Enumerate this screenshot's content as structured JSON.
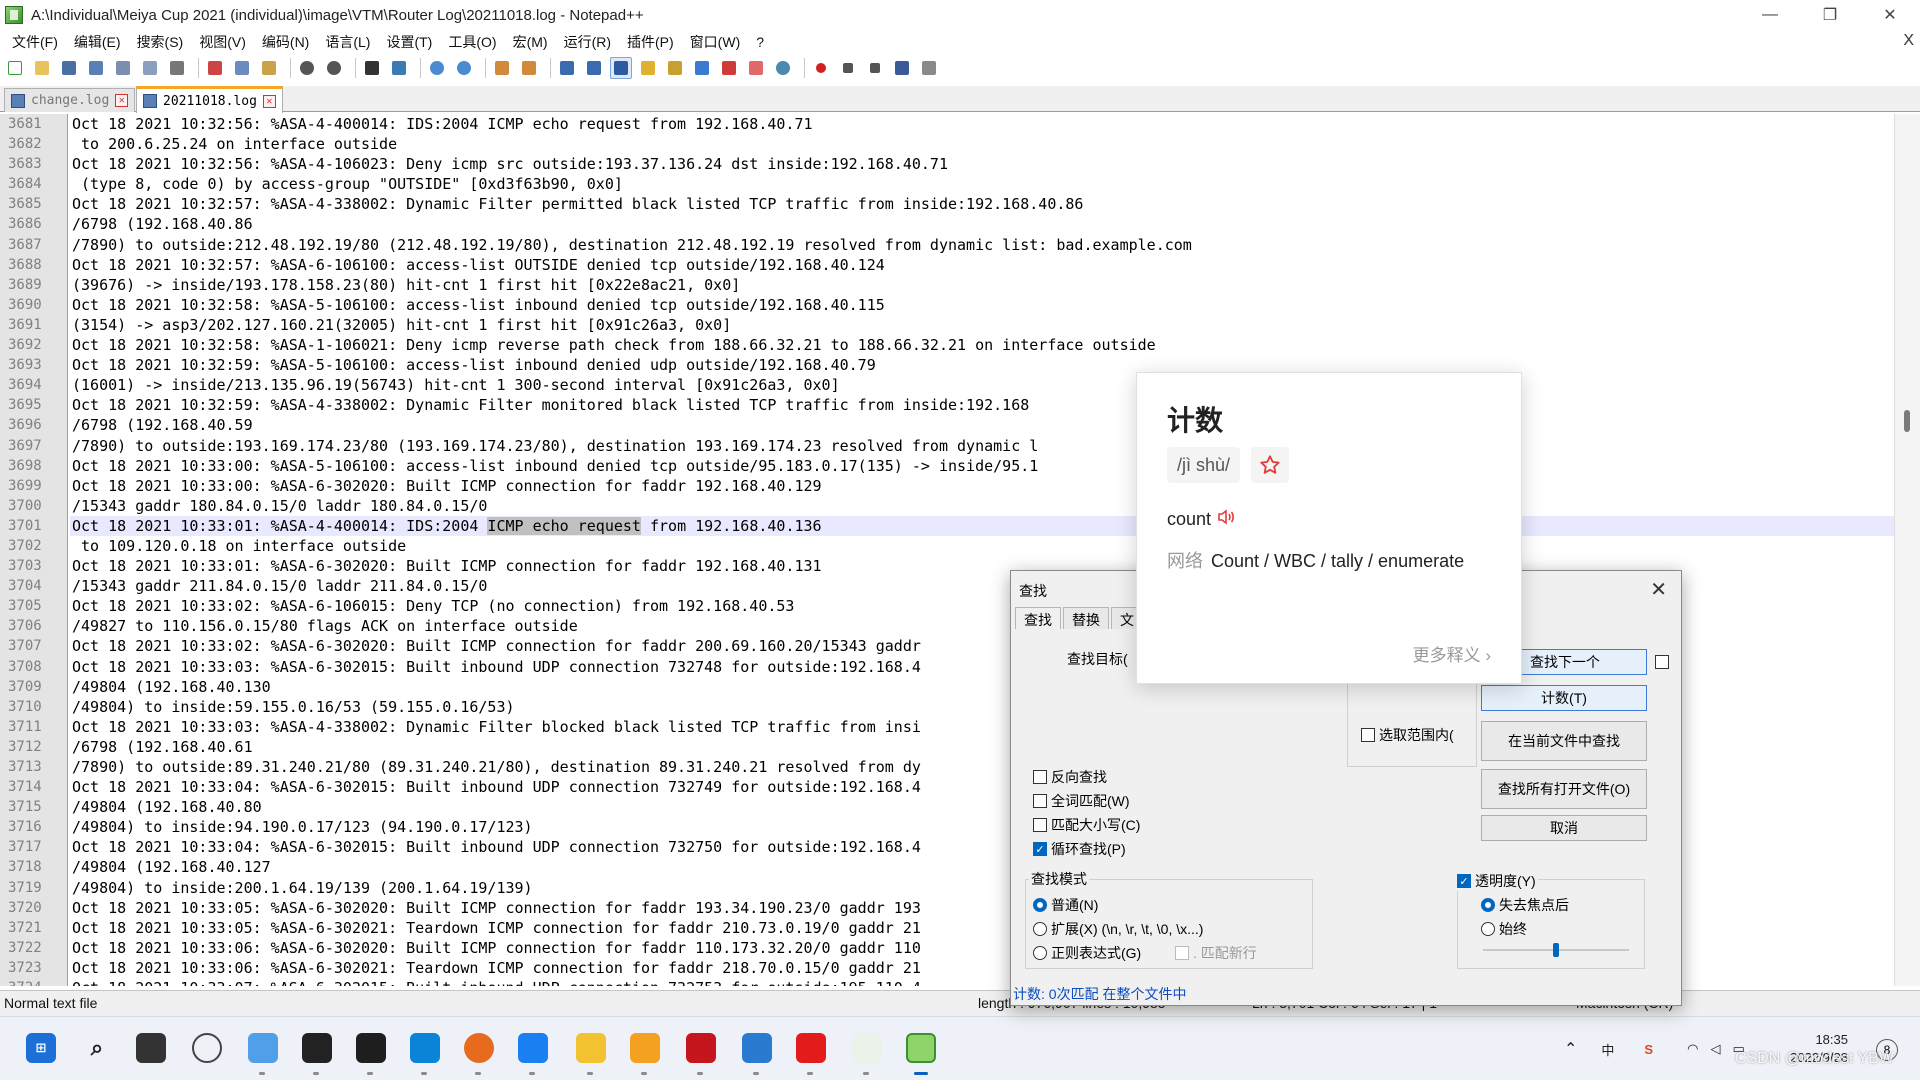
{
  "window": {
    "title": "A:\\Individual\\Meiya Cup 2021 (individual)\\image\\VTM\\Router Log\\20211018.log - Notepad++",
    "minimize": "—",
    "maximize": "❐",
    "close": "✕"
  },
  "menu": {
    "items": [
      "文件(F)",
      "编辑(E)",
      "搜索(S)",
      "视图(V)",
      "编码(N)",
      "语言(L)",
      "设置(T)",
      "工具(O)",
      "宏(M)",
      "运行(R)",
      "插件(P)",
      "窗口(W)",
      "?"
    ],
    "close": "X"
  },
  "tabs": [
    {
      "label": "change.log",
      "active": false
    },
    {
      "label": "20211018.log",
      "active": true
    }
  ],
  "editor": {
    "current_line": 3701,
    "selection": "ICMP echo request",
    "lines": [
      {
        "n": "3681",
        "t": "Oct 18 2021 10:32:56: %ASA-4-400014: IDS:2004 ICMP echo request from 192.168.40.71"
      },
      {
        "n": "3682",
        "t": " to 200.6.25.24 on interface outside"
      },
      {
        "n": "3683",
        "t": "Oct 18 2021 10:32:56: %ASA-4-106023: Deny icmp src outside:193.37.136.24 dst inside:192.168.40.71"
      },
      {
        "n": "3684",
        "t": " (type 8, code 0) by access-group \"OUTSIDE\" [0xd3f63b90, 0x0]"
      },
      {
        "n": "3685",
        "t": "Oct 18 2021 10:32:57: %ASA-4-338002: Dynamic Filter permitted black listed TCP traffic from inside:192.168.40.86"
      },
      {
        "n": "3686",
        "t": "/6798 (192.168.40.86"
      },
      {
        "n": "3687",
        "t": "/7890) to outside:212.48.192.19/80 (212.48.192.19/80), destination 212.48.192.19 resolved from dynamic list: bad.example.com"
      },
      {
        "n": "3688",
        "t": "Oct 18 2021 10:32:57: %ASA-6-106100: access-list OUTSIDE denied tcp outside/192.168.40.124"
      },
      {
        "n": "3689",
        "t": "(39676) -> inside/193.178.158.23(80) hit-cnt 1 first hit [0x22e8ac21, 0x0]"
      },
      {
        "n": "3690",
        "t": "Oct 18 2021 10:32:58: %ASA-5-106100: access-list inbound denied tcp outside/192.168.40.115"
      },
      {
        "n": "3691",
        "t": "(3154) -> asp3/202.127.160.21(32005) hit-cnt 1 first hit [0x91c26a3, 0x0]"
      },
      {
        "n": "3692",
        "t": "Oct 18 2021 10:32:58: %ASA-1-106021: Deny icmp reverse path check from 188.66.32.21 to 188.66.32.21 on interface outside"
      },
      {
        "n": "3693",
        "t": "Oct 18 2021 10:32:59: %ASA-5-106100: access-list inbound denied udp outside/192.168.40.79"
      },
      {
        "n": "3694",
        "t": "(16001) -> inside/213.135.96.19(56743) hit-cnt 1 300-second interval [0x91c26a3, 0x0]"
      },
      {
        "n": "3695",
        "t": "Oct 18 2021 10:32:59: %ASA-4-338002: Dynamic Filter monitored black listed TCP traffic from inside:192.168"
      },
      {
        "n": "3696",
        "t": "/6798 (192.168.40.59"
      },
      {
        "n": "3697",
        "t": "/7890) to outside:193.169.174.23/80 (193.169.174.23/80), destination 193.169.174.23 resolved from dynamic l"
      },
      {
        "n": "3698",
        "t": "Oct 18 2021 10:33:00: %ASA-5-106100: access-list inbound denied tcp outside/95.183.0.17(135) -> inside/95.1                             1c26a3, 0x0]"
      },
      {
        "n": "3699",
        "t": "Oct 18 2021 10:33:00: %ASA-6-302020: Built ICMP connection for faddr 192.168.40.129"
      },
      {
        "n": "3700",
        "t": "/15343 gaddr 180.84.0.15/0 laddr 180.84.0.15/0"
      },
      {
        "n": "3701",
        "t": "Oct 18 2021 10:33:01: %ASA-4-400014: IDS:2004 ICMP echo request from 192.168.40.136"
      },
      {
        "n": "3702",
        "t": " to 109.120.0.18 on interface outside"
      },
      {
        "n": "3703",
        "t": "Oct 18 2021 10:33:01: %ASA-6-302020: Built ICMP connection for faddr 192.168.40.131"
      },
      {
        "n": "3704",
        "t": "/15343 gaddr 211.84.0.15/0 laddr 211.84.0.15/0"
      },
      {
        "n": "3705",
        "t": "Oct 18 2021 10:33:02: %ASA-6-106015: Deny TCP (no connection) from 192.168.40.53"
      },
      {
        "n": "3706",
        "t": "/49827 to 110.156.0.15/80 flags ACK on interface outside"
      },
      {
        "n": "3707",
        "t": "Oct 18 2021 10:33:02: %ASA-6-302020: Built ICMP connection for faddr 200.69.160.20/15343 gaddr"
      },
      {
        "n": "3708",
        "t": "Oct 18 2021 10:33:03: %ASA-6-302015: Built inbound UDP connection 732748 for outside:192.168.4"
      },
      {
        "n": "3709",
        "t": "/49804 (192.168.40.130"
      },
      {
        "n": "3710",
        "t": "/49804) to inside:59.155.0.16/53 (59.155.0.16/53)"
      },
      {
        "n": "3711",
        "t": "Oct 18 2021 10:33:03: %ASA-4-338002: Dynamic Filter blocked black listed TCP traffic from insi"
      },
      {
        "n": "3712",
        "t": "/6798 (192.168.40.61"
      },
      {
        "n": "3713",
        "t": "/7890) to outside:89.31.240.21/80 (89.31.240.21/80), destination 89.31.240.21 resolved from dy"
      },
      {
        "n": "3714",
        "t": "Oct 18 2021 10:33:04: %ASA-6-302015: Built inbound UDP connection 732749 for outside:192.168.4"
      },
      {
        "n": "3715",
        "t": "/49804 (192.168.40.80"
      },
      {
        "n": "3716",
        "t": "/49804) to inside:94.190.0.17/123 (94.190.0.17/123)"
      },
      {
        "n": "3717",
        "t": "Oct 18 2021 10:33:04: %ASA-6-302015: Built inbound UDP connection 732750 for outside:192.168.4"
      },
      {
        "n": "3718",
        "t": "/49804 (192.168.40.127"
      },
      {
        "n": "3719",
        "t": "/49804) to inside:200.1.64.19/139 (200.1.64.19/139)"
      },
      {
        "n": "3720",
        "t": "Oct 18 2021 10:33:05: %ASA-6-302020: Built ICMP connection for faddr 193.34.190.23/0 gaddr 193"
      },
      {
        "n": "3721",
        "t": "Oct 18 2021 10:33:05: %ASA-6-302021: Teardown ICMP connection for faddr 210.73.0.19/0 gaddr 21"
      },
      {
        "n": "3722",
        "t": "Oct 18 2021 10:33:06: %ASA-6-302020: Built ICMP connection for faddr 110.173.32.20/0 gaddr 110"
      },
      {
        "n": "3723",
        "t": "Oct 18 2021 10:33:06: %ASA-6-302021: Teardown ICMP connection for faddr 218.70.0.15/0 gaddr 21"
      },
      {
        "n": "3724",
        "t": "Oct 18 2021 10:33:07: %ASA-6-302015: Built inbound UDP connection 732753 for outside:195.110.4                                                                   22/53)"
      }
    ]
  },
  "statusbar": {
    "file_type": "Normal text file",
    "length": "length : 976,907   lines : 10,985",
    "position": "Ln : 3,701   Col : 64   Sel : 17 | 1",
    "eol": "Macintosh (CR)"
  },
  "find_dialog": {
    "title": "查找",
    "tabs": [
      "查找",
      "替换",
      "文"
    ],
    "target_label": "查找目标(",
    "btn_find_next": "查找下一个",
    "btn_count": "计数(T)",
    "btn_find_in_current": "在当前文件中查找",
    "btn_find_all_open": "查找所有打开文件(O)",
    "btn_cancel": "取消",
    "in_selection": "选取范围内(",
    "opt_backward": "反向查找",
    "opt_whole_word": "全词匹配(W)",
    "opt_match_case": "匹配大小写(C)",
    "opt_wrap": "循环查找(P)",
    "mode_title": "查找模式",
    "mode_normal": "普通(N)",
    "mode_extended": "扩展(X) (\\n, \\r, \\t, \\0, \\x...)",
    "mode_regex": "正则表达式(G)",
    "mode_newline": ". 匹配新行",
    "transparency": "透明度(Y)",
    "trans_on_lose_focus": "失去焦点后",
    "trans_always": "始终",
    "status": "计数:  0次匹配 在整个文件中",
    "transparency_level": 0.5
  },
  "dictionary": {
    "word": "计数",
    "pinyin": "jì shù",
    "english": "count",
    "net_label": "网络",
    "net_meanings": "Count / WBC / tally / enumerate",
    "more": "更多释义 ›"
  },
  "taskbar": {
    "ime_label": "中",
    "time": "18:35",
    "date": "2022/9/28",
    "notifications": "8"
  },
  "watermark": "CSDN @modest YBW"
}
